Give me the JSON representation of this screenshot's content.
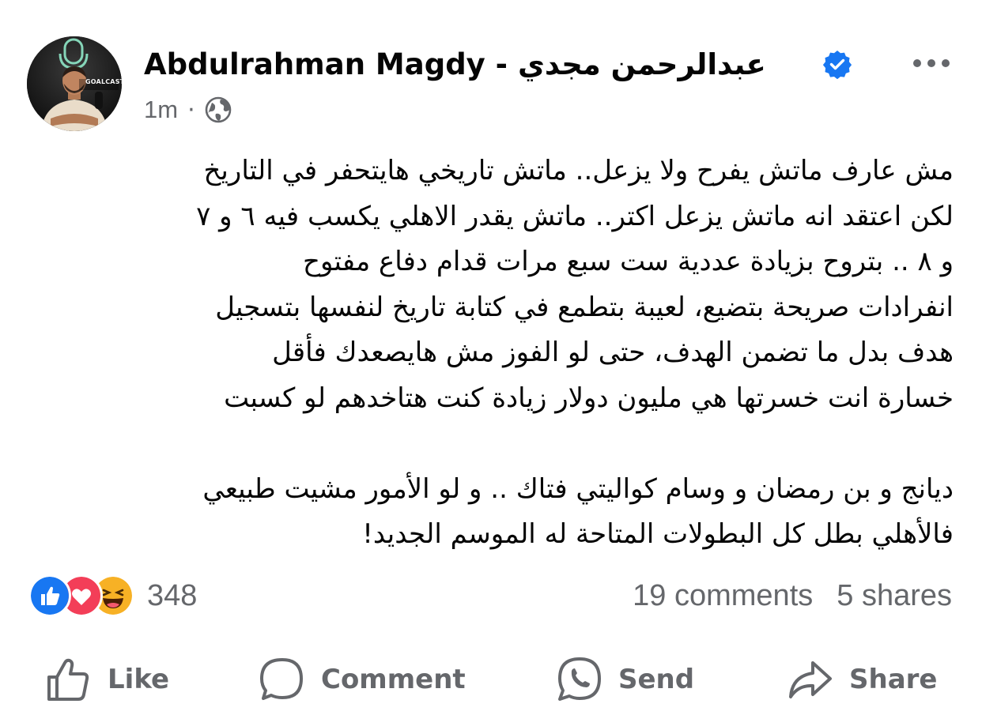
{
  "post": {
    "author": {
      "name": "Abdulrahman Magdy - عبدالرحمن  مجدي",
      "verified": true,
      "avatar_badge_text": "GOALCAST"
    },
    "timestamp": "1m",
    "separator": "·",
    "audience_icon": "globe-icon",
    "more_icon": "more-horizontal-icon",
    "text_lines": [
      "مش عارف ماتش يفرح ولا يزعل.. ماتش تاريخي هايتحفر في التاريخ",
      "لكن اعتقد انه ماتش يزعل اكتر.. ماتش يقدر الاهلي يكسب فيه ٦ و ٧",
      "و ٨ .. بتروح بزيادة عددية  ست سبع مرات قدام دفاع مفتوح",
      "انفرادات صريحة بتضيع، لعيبة بتطمع في كتابة تاريخ لنفسها بتسجيل",
      "هدف بدل ما تضمن الهدف، حتى لو الفوز مش هايصعدك فأقل",
      "خسارة انت خسرتها هي مليون دولار زيادة كنت هتاخدهم لو كسبت"
    ],
    "text_lines_2": [
      "ديانج و بن رمضان و وسام كواليتي فتاك .. و لو الأمور مشيت طبيعي",
      "فالأهلي بطل كل البطولات المتاحة له الموسم الجديد!"
    ]
  },
  "reactions": {
    "icons": [
      "like-icon",
      "love-icon",
      "haha-icon"
    ],
    "count": "348",
    "comments": "19 comments",
    "shares": "5 shares"
  },
  "actions": {
    "like": "Like",
    "comment": "Comment",
    "send": "Send",
    "share": "Share"
  },
  "colors": {
    "text": "#050505",
    "secondary": "#65676b",
    "like_blue": "#1877f2",
    "love_red": "#f33e58",
    "haha_yellow": "#f7b125",
    "verified_blue": "#1877f2"
  }
}
